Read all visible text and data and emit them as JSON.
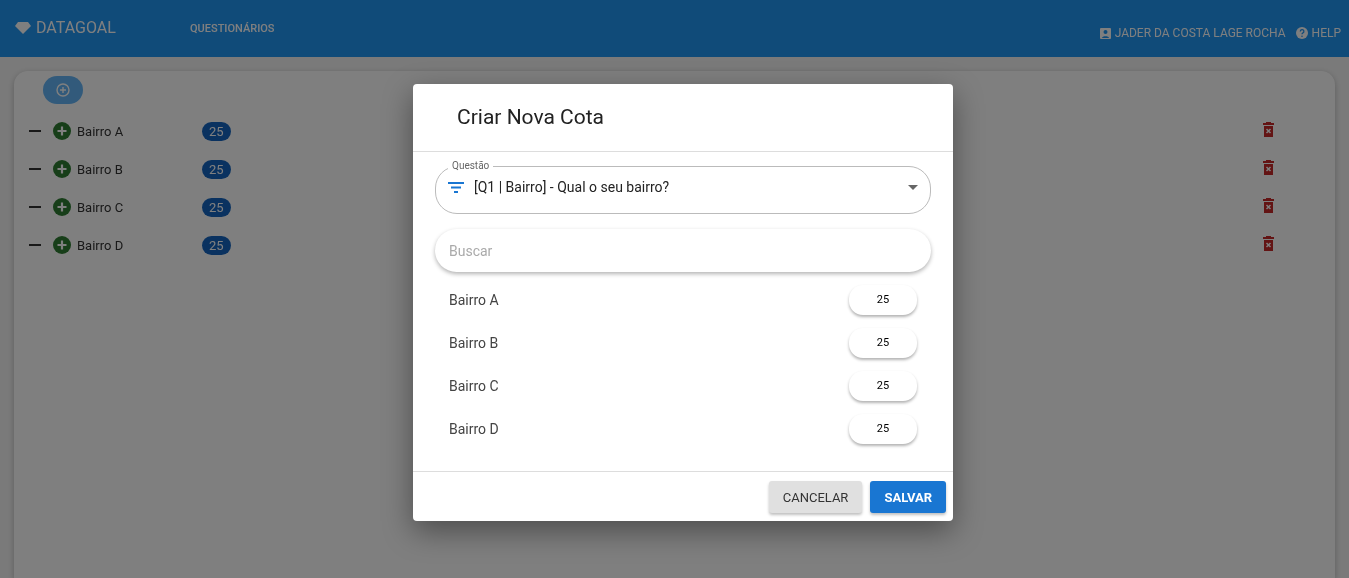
{
  "app_bar": {
    "brand": "DATAGOAL",
    "nav": [
      "QUESTIONÁRIOS"
    ],
    "user": "JADER DA COSTA LAGE ROCHA",
    "help": "HELP"
  },
  "quota_list": [
    {
      "name": "Bairro A",
      "count": "25"
    },
    {
      "name": "Bairro B",
      "count": "25"
    },
    {
      "name": "Bairro C",
      "count": "25"
    },
    {
      "name": "Bairro D",
      "count": "25"
    }
  ],
  "dialog": {
    "title": "Criar Nova Cota",
    "question_select": {
      "label": "Questão",
      "value": "[Q1 | Bairro] - Qual o seu bairro?"
    },
    "search": {
      "placeholder": "Buscar"
    },
    "options": [
      {
        "name": "Bairro A",
        "value": "25"
      },
      {
        "name": "Bairro B",
        "value": "25"
      },
      {
        "name": "Bairro C",
        "value": "25"
      },
      {
        "name": "Bairro D",
        "value": "25"
      }
    ],
    "buttons": [
      {
        "kind": "secondary",
        "label": "CANCELAR"
      },
      {
        "kind": "primary",
        "label": "SALVAR"
      }
    ]
  }
}
